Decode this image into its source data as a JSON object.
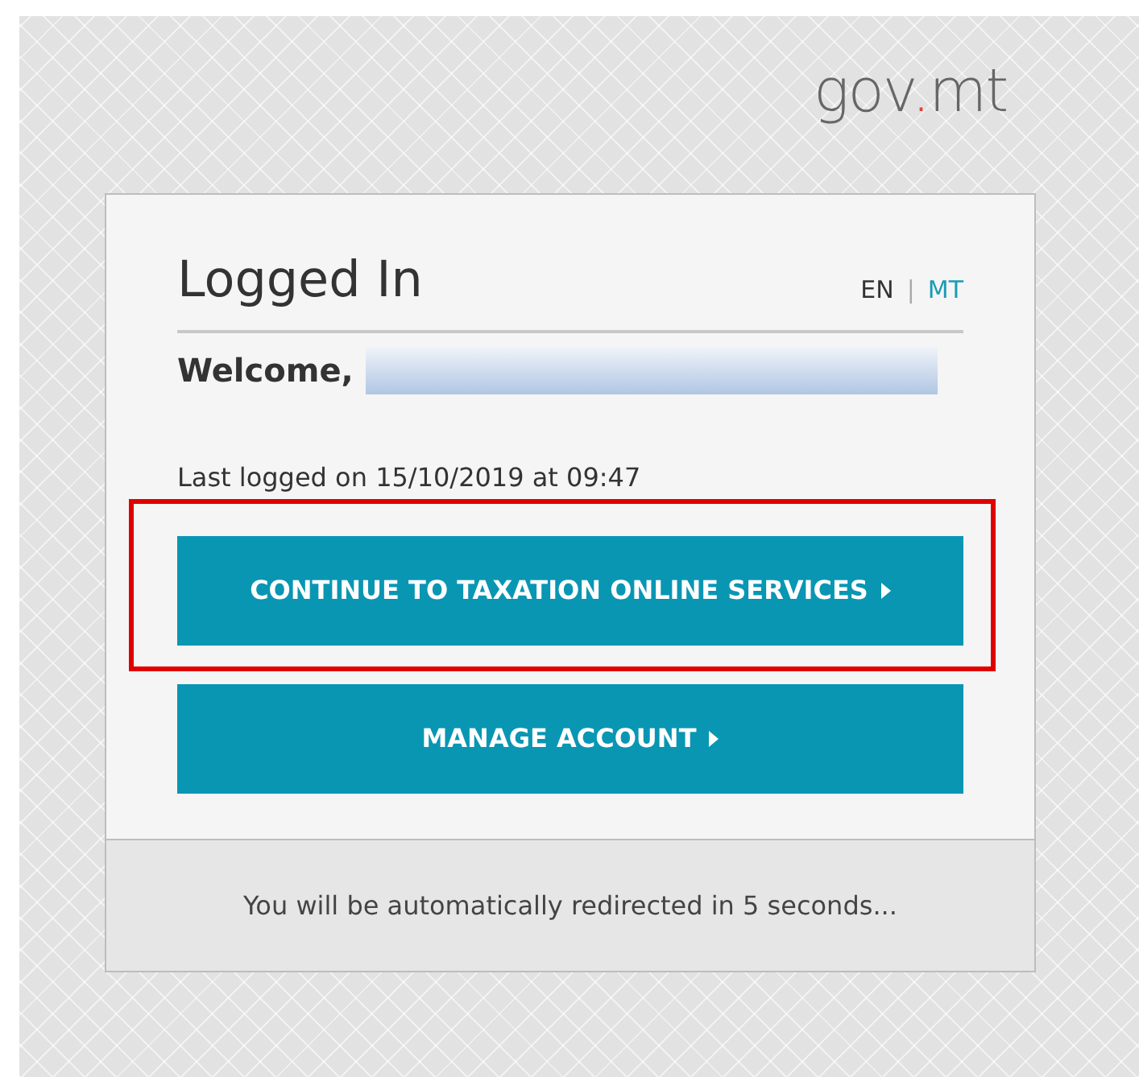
{
  "logo": [
    {
      "text": "gov",
      "accent": false
    },
    {
      "text": ".",
      "accent": true
    },
    {
      "text": "mt",
      "accent": false
    }
  ],
  "card": {
    "title": "Logged In",
    "language_separator": "|",
    "languages": [
      {
        "label": "EN",
        "selected": true
      },
      {
        "label": "MT",
        "selected": false
      }
    ],
    "welcome": {
      "text": "Welcome,",
      "name_redacted": true
    },
    "last_logged": "Last logged on 15/10/2019 at 09:47",
    "buttons": [
      {
        "label": "CONTINUE TO TAXATION ONLINE SERVICES",
        "highlighted": true
      },
      {
        "label": "MANAGE ACCOUNT",
        "highlighted": false
      }
    ],
    "footer": "You will be automatically redirected in 5 seconds..."
  }
}
